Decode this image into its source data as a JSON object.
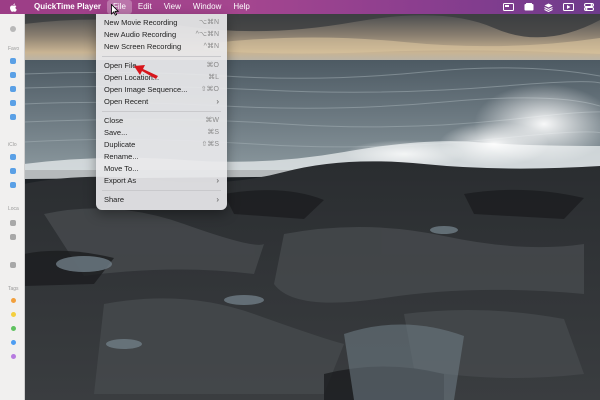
{
  "menubar": {
    "app_name": "QuickTime Player",
    "menus": [
      "File",
      "Edit",
      "View",
      "Window",
      "Help"
    ],
    "open_menu": "File",
    "status_icons": [
      "screen-mirror-icon",
      "wallet-icon",
      "layers-icon",
      "video-record-icon",
      "control-center-icon"
    ]
  },
  "file_menu": {
    "items": [
      {
        "label": "New Movie Recording",
        "shortcut": "⌥⌘N"
      },
      {
        "label": "New Audio Recording",
        "shortcut": "^⌥⌘N"
      },
      {
        "label": "New Screen Recording",
        "shortcut": "^⌘N"
      },
      {
        "label": "Open File...",
        "shortcut": "⌘O"
      },
      {
        "label": "Open Location...",
        "shortcut": "⌘L"
      },
      {
        "label": "Open Image Sequence...",
        "shortcut": "⇧⌘O"
      },
      {
        "label": "Open Recent",
        "submenu": true
      },
      {
        "label": "Close",
        "shortcut": "⌘W"
      },
      {
        "label": "Save...",
        "shortcut": "⌘S"
      },
      {
        "label": "Duplicate",
        "shortcut": "⇧⌘S"
      },
      {
        "label": "Rename..."
      },
      {
        "label": "Move To..."
      },
      {
        "label": "Export As",
        "submenu": true
      },
      {
        "label": "Share",
        "submenu": true
      }
    ],
    "submenu_arrow": "›"
  },
  "sidebar": {
    "sections": [
      "Favo",
      "iClo",
      "Loca",
      "Tags"
    ],
    "tag_colors": [
      "#f2a03d",
      "#f4cf3e",
      "#5fc25f",
      "#4d9df2",
      "#b77be0"
    ]
  },
  "colors": {
    "menubar_accent": "#9c3d86",
    "annotation_arrow": "#d8161c"
  }
}
